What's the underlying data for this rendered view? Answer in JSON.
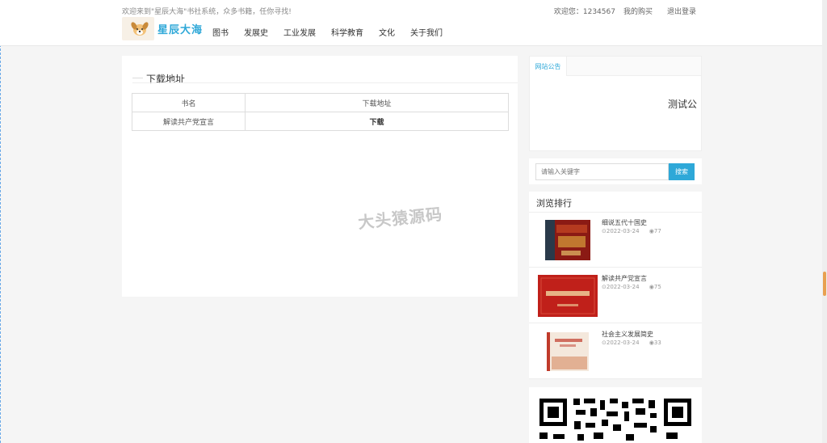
{
  "header": {
    "welcome": "欢迎来到\"星辰大海\"书社系统，众多书籍，任你寻找!",
    "user_greeting": "欢迎您：1234567",
    "my_purchases": "我的购买",
    "logout": "退出登录",
    "logo_text": "星辰大海",
    "nav": [
      "图书",
      "发展史",
      "工业发展",
      "科学教育",
      "文化",
      "关于我们"
    ]
  },
  "main": {
    "section_title": "下载地址",
    "table": {
      "headers": [
        "书名",
        "下载地址"
      ],
      "rows": [
        [
          "解读共产党宣言",
          "下载"
        ]
      ]
    },
    "watermark": "大头猿源码"
  },
  "sidebar": {
    "notice_tab": "网站公告",
    "notice_content": "测试公",
    "search_placeholder": "请输入关键字",
    "search_button": "搜索",
    "rank_title": "浏览排行",
    "rank_items": [
      {
        "name": "细说五代十国史",
        "date": "2022-03-24",
        "views": "77"
      },
      {
        "name": "解读共产党宣言",
        "date": "2022-03-24",
        "views": "75"
      },
      {
        "name": "社会主义发展简史",
        "date": "2022-03-24",
        "views": "33"
      }
    ]
  },
  "colors": {
    "accent": "#2ea8d8",
    "background": "#f5f5f5"
  }
}
